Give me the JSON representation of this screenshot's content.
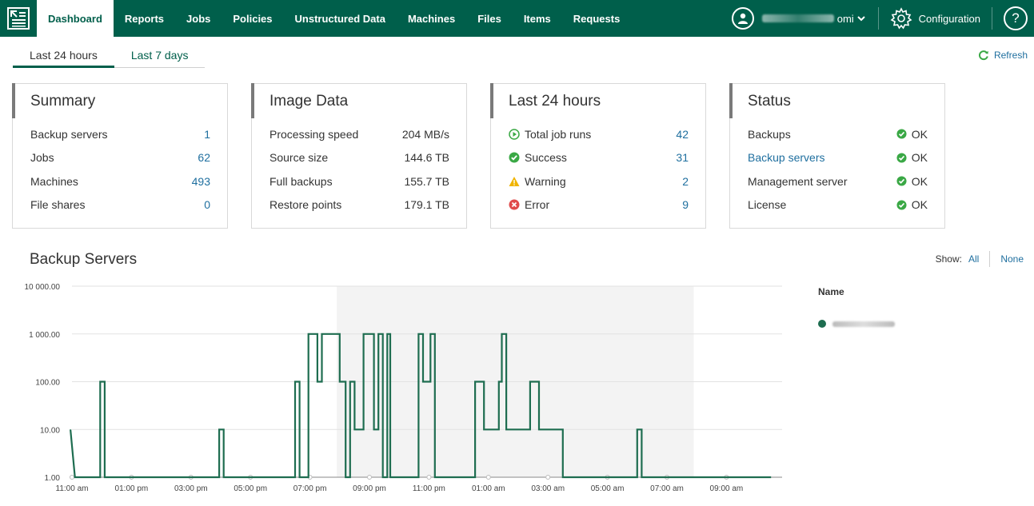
{
  "nav": {
    "items": [
      {
        "label": "Dashboard",
        "active": true
      },
      {
        "label": "Reports"
      },
      {
        "label": "Jobs"
      },
      {
        "label": "Policies"
      },
      {
        "label": "Unstructured Data"
      },
      {
        "label": "Machines"
      },
      {
        "label": "Files"
      },
      {
        "label": "Items"
      },
      {
        "label": "Requests"
      }
    ],
    "user_suffix": "omi",
    "configuration": "Configuration",
    "help": "?"
  },
  "period_tabs": [
    "Last 24 hours",
    "Last 7 days"
  ],
  "refresh": "Refresh",
  "cards": {
    "summary": {
      "title": "Summary",
      "rows": [
        {
          "label": "Backup servers",
          "value": "1"
        },
        {
          "label": "Jobs",
          "value": "62"
        },
        {
          "label": "Machines",
          "value": "493"
        },
        {
          "label": "File shares",
          "value": "0"
        }
      ]
    },
    "image_data": {
      "title": "Image Data",
      "rows": [
        {
          "label": "Processing speed",
          "value": "204 MB/s"
        },
        {
          "label": "Source size",
          "value": "144.6 TB"
        },
        {
          "label": "Full backups",
          "value": "155.7 TB"
        },
        {
          "label": "Restore points",
          "value": "179.1 TB"
        }
      ]
    },
    "last24": {
      "title": "Last 24 hours",
      "rows": [
        {
          "label": "Total job runs",
          "value": "42"
        },
        {
          "label": "Success",
          "value": "31"
        },
        {
          "label": "Warning",
          "value": "2"
        },
        {
          "label": "Error",
          "value": "9"
        }
      ]
    },
    "status": {
      "title": "Status",
      "rows": [
        {
          "label": "Backups",
          "value": "OK"
        },
        {
          "label": "Backup servers",
          "value": "OK"
        },
        {
          "label": "Management server",
          "value": "OK"
        },
        {
          "label": "License",
          "value": "OK"
        }
      ]
    }
  },
  "backup_servers": {
    "title": "Backup Servers",
    "show_label": "Show:",
    "show_all": "All",
    "show_none": "None",
    "legend_title": "Name"
  },
  "colors": {
    "brand": "#005f4b",
    "link": "#1f6f9f",
    "series": "#1e6d50",
    "ok": "#3aa845",
    "warning": "#f0b400",
    "error": "#e04b4b"
  },
  "chart_data": {
    "type": "line",
    "y_scale": "log",
    "ylim": [
      1,
      10000
    ],
    "y_ticks": [
      "1.00",
      "10.00",
      "100.00",
      "1 000.00",
      "10 000.00"
    ],
    "x_ticks": [
      "11:00 am",
      "01:00 pm",
      "03:00 pm",
      "05:00 pm",
      "07:00 pm",
      "09:00 pm",
      "11:00 pm",
      "01:00 am",
      "03:00 am",
      "05:00 am",
      "07:00 am",
      "09:00 am"
    ],
    "x_hours": [
      0,
      2,
      4,
      6,
      8,
      10,
      12,
      14,
      16,
      18,
      20,
      22
    ],
    "highlight_hours": [
      8.9,
      20.9
    ],
    "step": true,
    "series": [
      {
        "points": [
          [
            -0.05,
            10
          ],
          [
            0.1,
            1
          ],
          [
            0.95,
            1
          ],
          [
            0.95,
            100
          ],
          [
            1.1,
            100
          ],
          [
            1.1,
            1
          ],
          [
            4.95,
            1
          ],
          [
            4.95,
            10
          ],
          [
            5.1,
            10
          ],
          [
            5.1,
            1
          ],
          [
            7.5,
            1
          ],
          [
            7.5,
            100
          ],
          [
            7.65,
            100
          ],
          [
            7.65,
            1
          ],
          [
            7.95,
            1
          ],
          [
            7.95,
            1000
          ],
          [
            8.25,
            1000
          ],
          [
            8.25,
            100
          ],
          [
            8.4,
            100
          ],
          [
            8.4,
            1000
          ],
          [
            9.0,
            1000
          ],
          [
            9.0,
            100
          ],
          [
            9.2,
            100
          ],
          [
            9.2,
            1
          ],
          [
            9.35,
            1
          ],
          [
            9.35,
            100
          ],
          [
            9.5,
            100
          ],
          [
            9.5,
            10
          ],
          [
            9.8,
            10
          ],
          [
            9.8,
            1000
          ],
          [
            10.15,
            1000
          ],
          [
            10.15,
            10
          ],
          [
            10.3,
            10
          ],
          [
            10.3,
            1000
          ],
          [
            10.45,
            1000
          ],
          [
            10.45,
            1
          ],
          [
            10.6,
            1
          ],
          [
            10.6,
            1000
          ],
          [
            10.7,
            1000
          ],
          [
            10.7,
            1
          ],
          [
            11.65,
            1
          ],
          [
            11.65,
            1000
          ],
          [
            11.8,
            1000
          ],
          [
            11.8,
            100
          ],
          [
            12.05,
            100
          ],
          [
            12.05,
            1000
          ],
          [
            12.2,
            1000
          ],
          [
            12.2,
            1
          ],
          [
            13.55,
            1
          ],
          [
            13.55,
            100
          ],
          [
            13.85,
            100
          ],
          [
            13.85,
            10
          ],
          [
            14.35,
            10
          ],
          [
            14.35,
            100
          ],
          [
            14.45,
            100
          ],
          [
            14.45,
            1000
          ],
          [
            14.6,
            1000
          ],
          [
            14.6,
            10
          ],
          [
            15.4,
            10
          ],
          [
            15.4,
            100
          ],
          [
            15.7,
            100
          ],
          [
            15.7,
            10
          ],
          [
            16.5,
            10
          ],
          [
            16.5,
            1
          ],
          [
            19.0,
            1
          ],
          [
            19.0,
            10
          ],
          [
            19.15,
            10
          ],
          [
            19.15,
            1
          ],
          [
            23.5,
            1
          ]
        ]
      }
    ]
  }
}
